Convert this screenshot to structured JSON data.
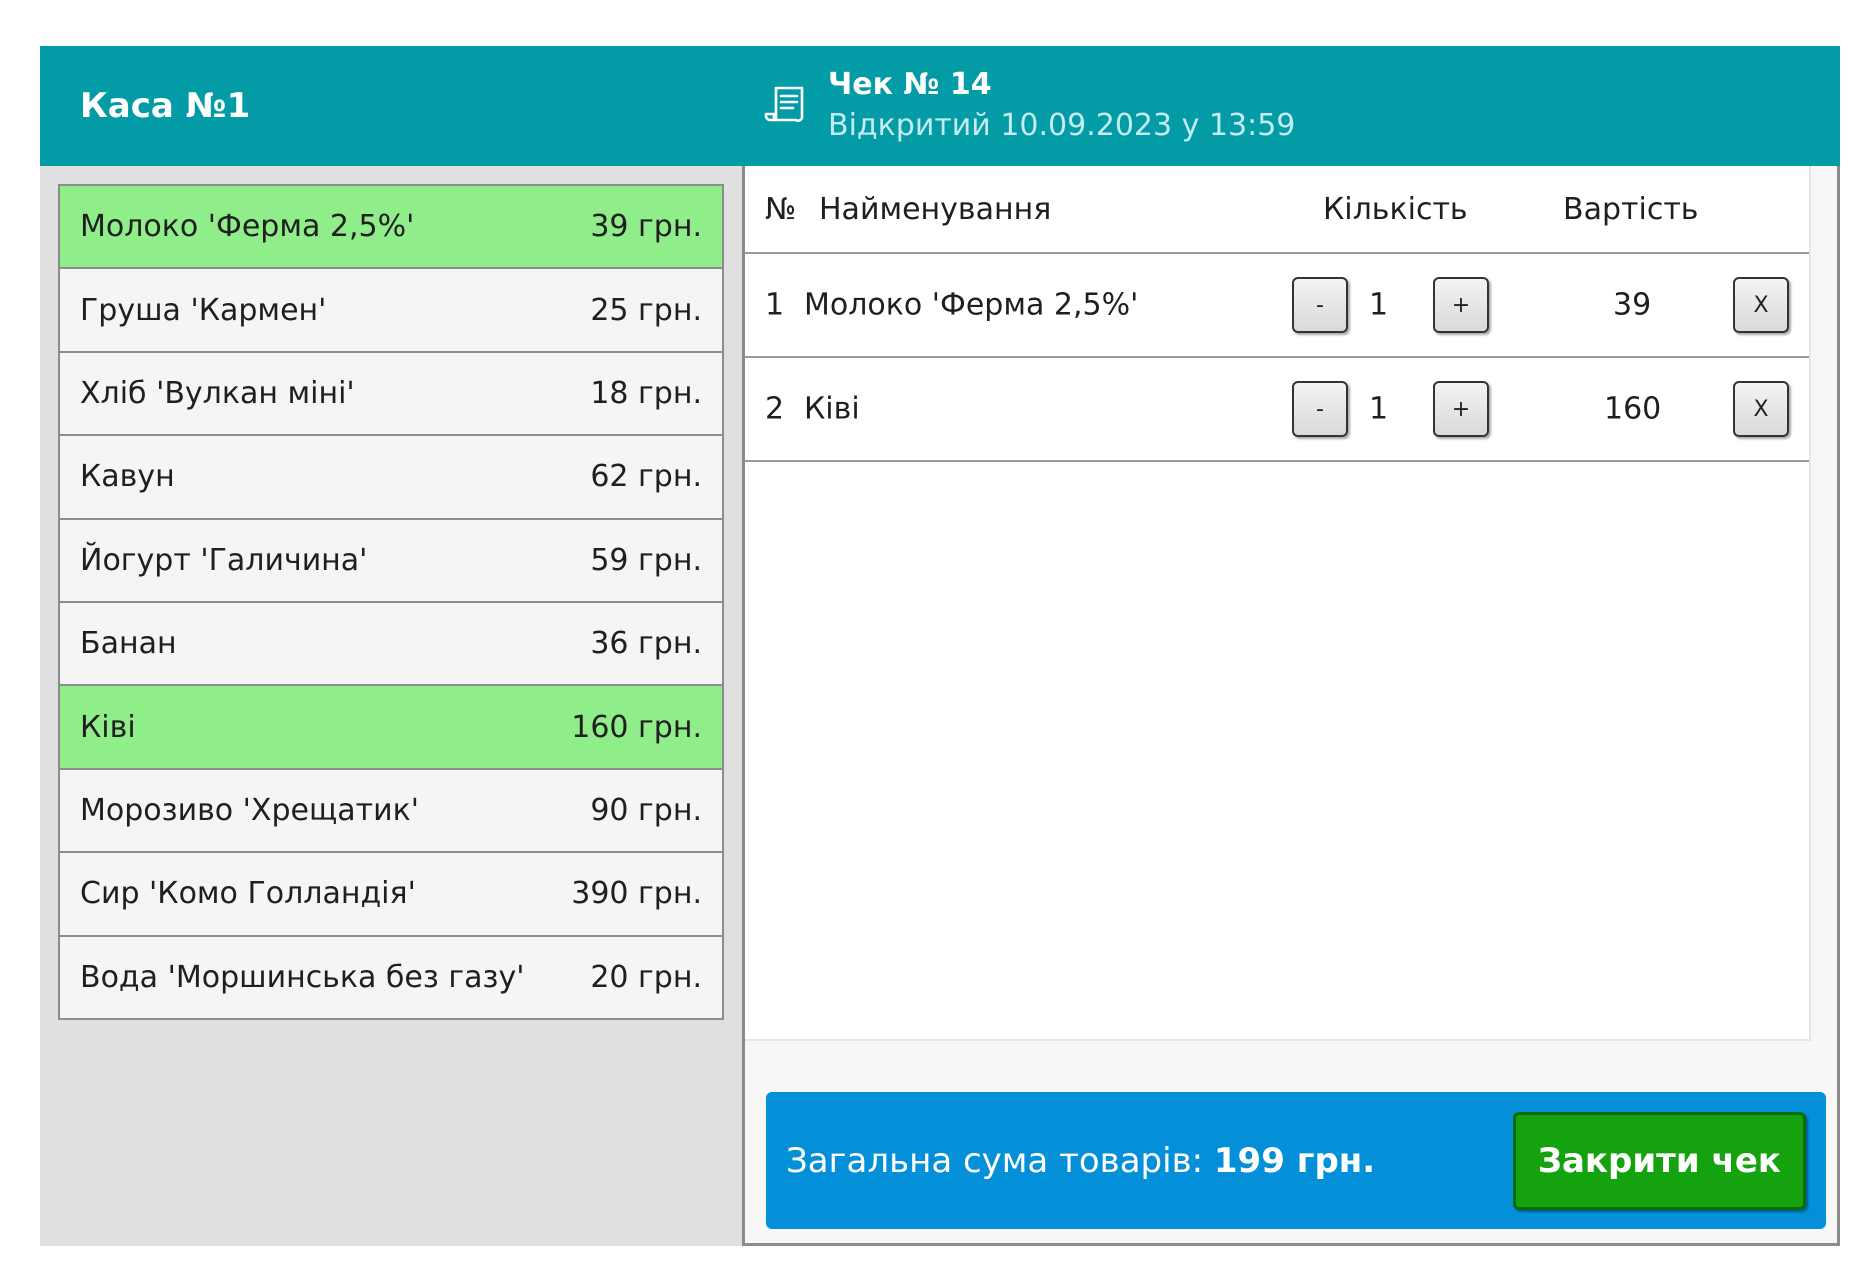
{
  "register": {
    "title": "Каса №1"
  },
  "products": [
    {
      "name": "Молоко 'Ферма 2,5%'",
      "price": "39 грн.",
      "selected": true
    },
    {
      "name": "Груша 'Кармен'",
      "price": "25 грн.",
      "selected": false
    },
    {
      "name": "Хліб 'Вулкан міні'",
      "price": "18 грн.",
      "selected": false
    },
    {
      "name": "Кавун",
      "price": "62 грн.",
      "selected": false
    },
    {
      "name": "Йогурт 'Галичина'",
      "price": "59 грн.",
      "selected": false
    },
    {
      "name": "Банан",
      "price": "36 грн.",
      "selected": false
    },
    {
      "name": "Ківі",
      "price": "160 грн.",
      "selected": true
    },
    {
      "name": "Морозиво 'Хрещатик'",
      "price": "90 грн.",
      "selected": false
    },
    {
      "name": "Сир 'Комо Голландія'",
      "price": "390 грн.",
      "selected": false
    },
    {
      "name": "Вода 'Моршинська без газу'",
      "price": "20 грн.",
      "selected": false
    }
  ],
  "receipt": {
    "title": "Чек № 14",
    "subtitle": "Відкритий 10.09.2023 у 13:59",
    "icon": "receipt-icon"
  },
  "table": {
    "headers": {
      "no": "№",
      "name": "Найменування",
      "qty": "Кількість",
      "cost": "Вартість"
    },
    "rows": [
      {
        "no": "1",
        "name": "Молоко 'Ферма 2,5%'",
        "qty": "1",
        "cost": "39"
      },
      {
        "no": "2",
        "name": "Ківі",
        "qty": "1",
        "cost": "160"
      }
    ],
    "minus_label": "-",
    "plus_label": "+",
    "remove_label": "X"
  },
  "footer": {
    "total_label": "Загальна сума товарів:",
    "total_value": "199 грн.",
    "close_label": "Закрити чек"
  },
  "colors": {
    "header": "#039ba6",
    "selected": "#90ee8a",
    "footer": "#0490d9",
    "close_button": "#14a30e"
  }
}
